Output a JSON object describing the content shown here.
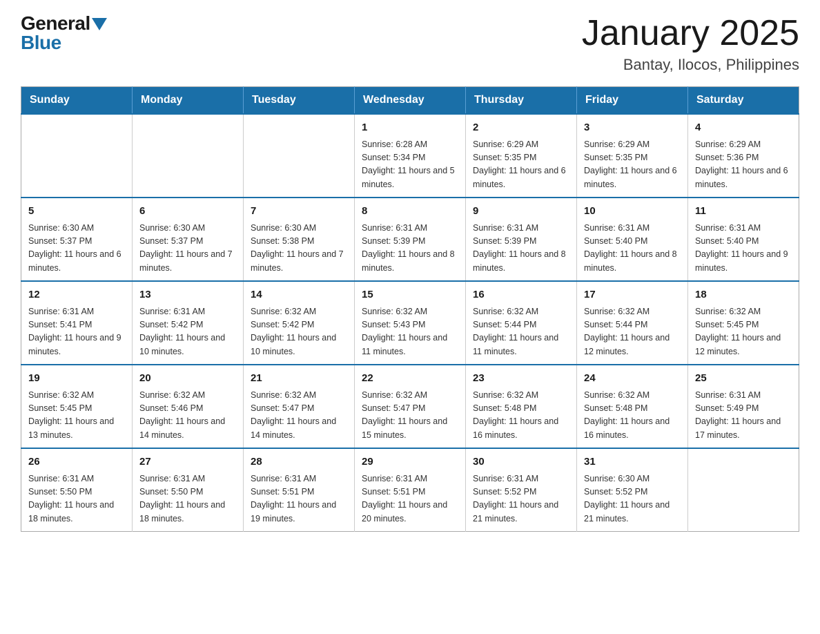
{
  "logo": {
    "general": "General",
    "blue": "Blue"
  },
  "title": "January 2025",
  "subtitle": "Bantay, Ilocos, Philippines",
  "days_of_week": [
    "Sunday",
    "Monday",
    "Tuesday",
    "Wednesday",
    "Thursday",
    "Friday",
    "Saturday"
  ],
  "weeks": [
    [
      {
        "day": "",
        "info": ""
      },
      {
        "day": "",
        "info": ""
      },
      {
        "day": "",
        "info": ""
      },
      {
        "day": "1",
        "info": "Sunrise: 6:28 AM\nSunset: 5:34 PM\nDaylight: 11 hours and 5 minutes."
      },
      {
        "day": "2",
        "info": "Sunrise: 6:29 AM\nSunset: 5:35 PM\nDaylight: 11 hours and 6 minutes."
      },
      {
        "day": "3",
        "info": "Sunrise: 6:29 AM\nSunset: 5:35 PM\nDaylight: 11 hours and 6 minutes."
      },
      {
        "day": "4",
        "info": "Sunrise: 6:29 AM\nSunset: 5:36 PM\nDaylight: 11 hours and 6 minutes."
      }
    ],
    [
      {
        "day": "5",
        "info": "Sunrise: 6:30 AM\nSunset: 5:37 PM\nDaylight: 11 hours and 6 minutes."
      },
      {
        "day": "6",
        "info": "Sunrise: 6:30 AM\nSunset: 5:37 PM\nDaylight: 11 hours and 7 minutes."
      },
      {
        "day": "7",
        "info": "Sunrise: 6:30 AM\nSunset: 5:38 PM\nDaylight: 11 hours and 7 minutes."
      },
      {
        "day": "8",
        "info": "Sunrise: 6:31 AM\nSunset: 5:39 PM\nDaylight: 11 hours and 8 minutes."
      },
      {
        "day": "9",
        "info": "Sunrise: 6:31 AM\nSunset: 5:39 PM\nDaylight: 11 hours and 8 minutes."
      },
      {
        "day": "10",
        "info": "Sunrise: 6:31 AM\nSunset: 5:40 PM\nDaylight: 11 hours and 8 minutes."
      },
      {
        "day": "11",
        "info": "Sunrise: 6:31 AM\nSunset: 5:40 PM\nDaylight: 11 hours and 9 minutes."
      }
    ],
    [
      {
        "day": "12",
        "info": "Sunrise: 6:31 AM\nSunset: 5:41 PM\nDaylight: 11 hours and 9 minutes."
      },
      {
        "day": "13",
        "info": "Sunrise: 6:31 AM\nSunset: 5:42 PM\nDaylight: 11 hours and 10 minutes."
      },
      {
        "day": "14",
        "info": "Sunrise: 6:32 AM\nSunset: 5:42 PM\nDaylight: 11 hours and 10 minutes."
      },
      {
        "day": "15",
        "info": "Sunrise: 6:32 AM\nSunset: 5:43 PM\nDaylight: 11 hours and 11 minutes."
      },
      {
        "day": "16",
        "info": "Sunrise: 6:32 AM\nSunset: 5:44 PM\nDaylight: 11 hours and 11 minutes."
      },
      {
        "day": "17",
        "info": "Sunrise: 6:32 AM\nSunset: 5:44 PM\nDaylight: 11 hours and 12 minutes."
      },
      {
        "day": "18",
        "info": "Sunrise: 6:32 AM\nSunset: 5:45 PM\nDaylight: 11 hours and 12 minutes."
      }
    ],
    [
      {
        "day": "19",
        "info": "Sunrise: 6:32 AM\nSunset: 5:45 PM\nDaylight: 11 hours and 13 minutes."
      },
      {
        "day": "20",
        "info": "Sunrise: 6:32 AM\nSunset: 5:46 PM\nDaylight: 11 hours and 14 minutes."
      },
      {
        "day": "21",
        "info": "Sunrise: 6:32 AM\nSunset: 5:47 PM\nDaylight: 11 hours and 14 minutes."
      },
      {
        "day": "22",
        "info": "Sunrise: 6:32 AM\nSunset: 5:47 PM\nDaylight: 11 hours and 15 minutes."
      },
      {
        "day": "23",
        "info": "Sunrise: 6:32 AM\nSunset: 5:48 PM\nDaylight: 11 hours and 16 minutes."
      },
      {
        "day": "24",
        "info": "Sunrise: 6:32 AM\nSunset: 5:48 PM\nDaylight: 11 hours and 16 minutes."
      },
      {
        "day": "25",
        "info": "Sunrise: 6:31 AM\nSunset: 5:49 PM\nDaylight: 11 hours and 17 minutes."
      }
    ],
    [
      {
        "day": "26",
        "info": "Sunrise: 6:31 AM\nSunset: 5:50 PM\nDaylight: 11 hours and 18 minutes."
      },
      {
        "day": "27",
        "info": "Sunrise: 6:31 AM\nSunset: 5:50 PM\nDaylight: 11 hours and 18 minutes."
      },
      {
        "day": "28",
        "info": "Sunrise: 6:31 AM\nSunset: 5:51 PM\nDaylight: 11 hours and 19 minutes."
      },
      {
        "day": "29",
        "info": "Sunrise: 6:31 AM\nSunset: 5:51 PM\nDaylight: 11 hours and 20 minutes."
      },
      {
        "day": "30",
        "info": "Sunrise: 6:31 AM\nSunset: 5:52 PM\nDaylight: 11 hours and 21 minutes."
      },
      {
        "day": "31",
        "info": "Sunrise: 6:30 AM\nSunset: 5:52 PM\nDaylight: 11 hours and 21 minutes."
      },
      {
        "day": "",
        "info": ""
      }
    ]
  ]
}
